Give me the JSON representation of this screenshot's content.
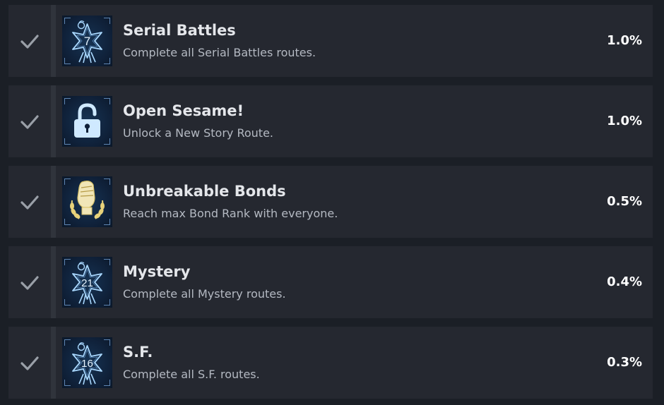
{
  "achievements": [
    {
      "title": "Serial Battles",
      "description": "Complete all Serial Battles routes.",
      "percent": "1.0%",
      "icon": "star-badge-icon",
      "badge_number": "7",
      "unlocked": true
    },
    {
      "title": "Open Sesame!",
      "description": "Unlock a New Story Route.",
      "percent": "1.0%",
      "icon": "padlock-icon",
      "unlocked": true
    },
    {
      "title": "Unbreakable Bonds",
      "description": "Reach max Bond Rank with everyone.",
      "percent": "0.5%",
      "icon": "fist-laurel-icon",
      "unlocked": true
    },
    {
      "title": "Mystery",
      "description": "Complete all Mystery routes.",
      "percent": "0.4%",
      "icon": "star-badge-icon",
      "badge_number": "21",
      "unlocked": true
    },
    {
      "title": "S.F.",
      "description": "Complete all S.F. routes.",
      "percent": "0.3%",
      "icon": "star-badge-icon",
      "badge_number": "16",
      "unlocked": true
    }
  ],
  "colors": {
    "background": "#1b1f26",
    "row": "#252830",
    "check": "#9aa0a8",
    "badge_blue": "#a9d8ff",
    "badge_gold": "#e8d27a"
  }
}
